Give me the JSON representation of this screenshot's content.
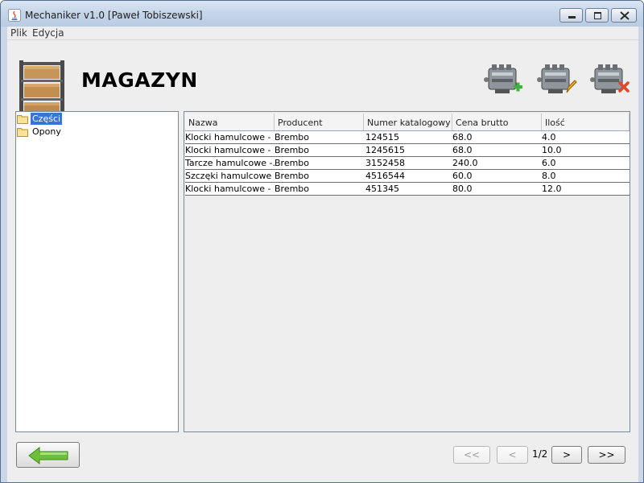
{
  "window": {
    "title": "Mechaniker v1.0 [Paweł Tobiszewski]"
  },
  "menu": [
    "Plik",
    "Edycja"
  ],
  "header": {
    "title": "MAGAZYN"
  },
  "toolbar": {
    "icons": [
      "engine-add-icon",
      "engine-edit-icon",
      "engine-delete-icon"
    ]
  },
  "tree": {
    "items": [
      {
        "label": "Części",
        "selected": true
      },
      {
        "label": "Opony",
        "selected": false
      }
    ]
  },
  "table": {
    "columns": [
      "Nazwa",
      "Producent",
      "Numer katalogowy",
      "Cena brutto",
      "Ilość"
    ],
    "rows": [
      [
        "Klocki hamulcowe - ...",
        "Brembo",
        "124515",
        "68.0",
        "4.0"
      ],
      [
        "Klocki hamulcowe - ...",
        "Brembo",
        "1245615",
        "68.0",
        "10.0"
      ],
      [
        "Tarcze hamulcowe -...",
        "Brembo",
        "3152458",
        "240.0",
        "6.0"
      ],
      [
        "Szczęki hamulcowe",
        "Brembo",
        "4516544",
        "60.0",
        "8.0"
      ],
      [
        "Klocki hamulcowe - ...",
        "Brembo",
        "451345",
        "80.0",
        "12.0"
      ]
    ]
  },
  "pagination": {
    "first": "<<",
    "prev": "<",
    "page": "1/2",
    "next": ">",
    "last": ">>"
  },
  "colors": {
    "selection": "#3875d7",
    "back_arrow": "#66b832"
  }
}
